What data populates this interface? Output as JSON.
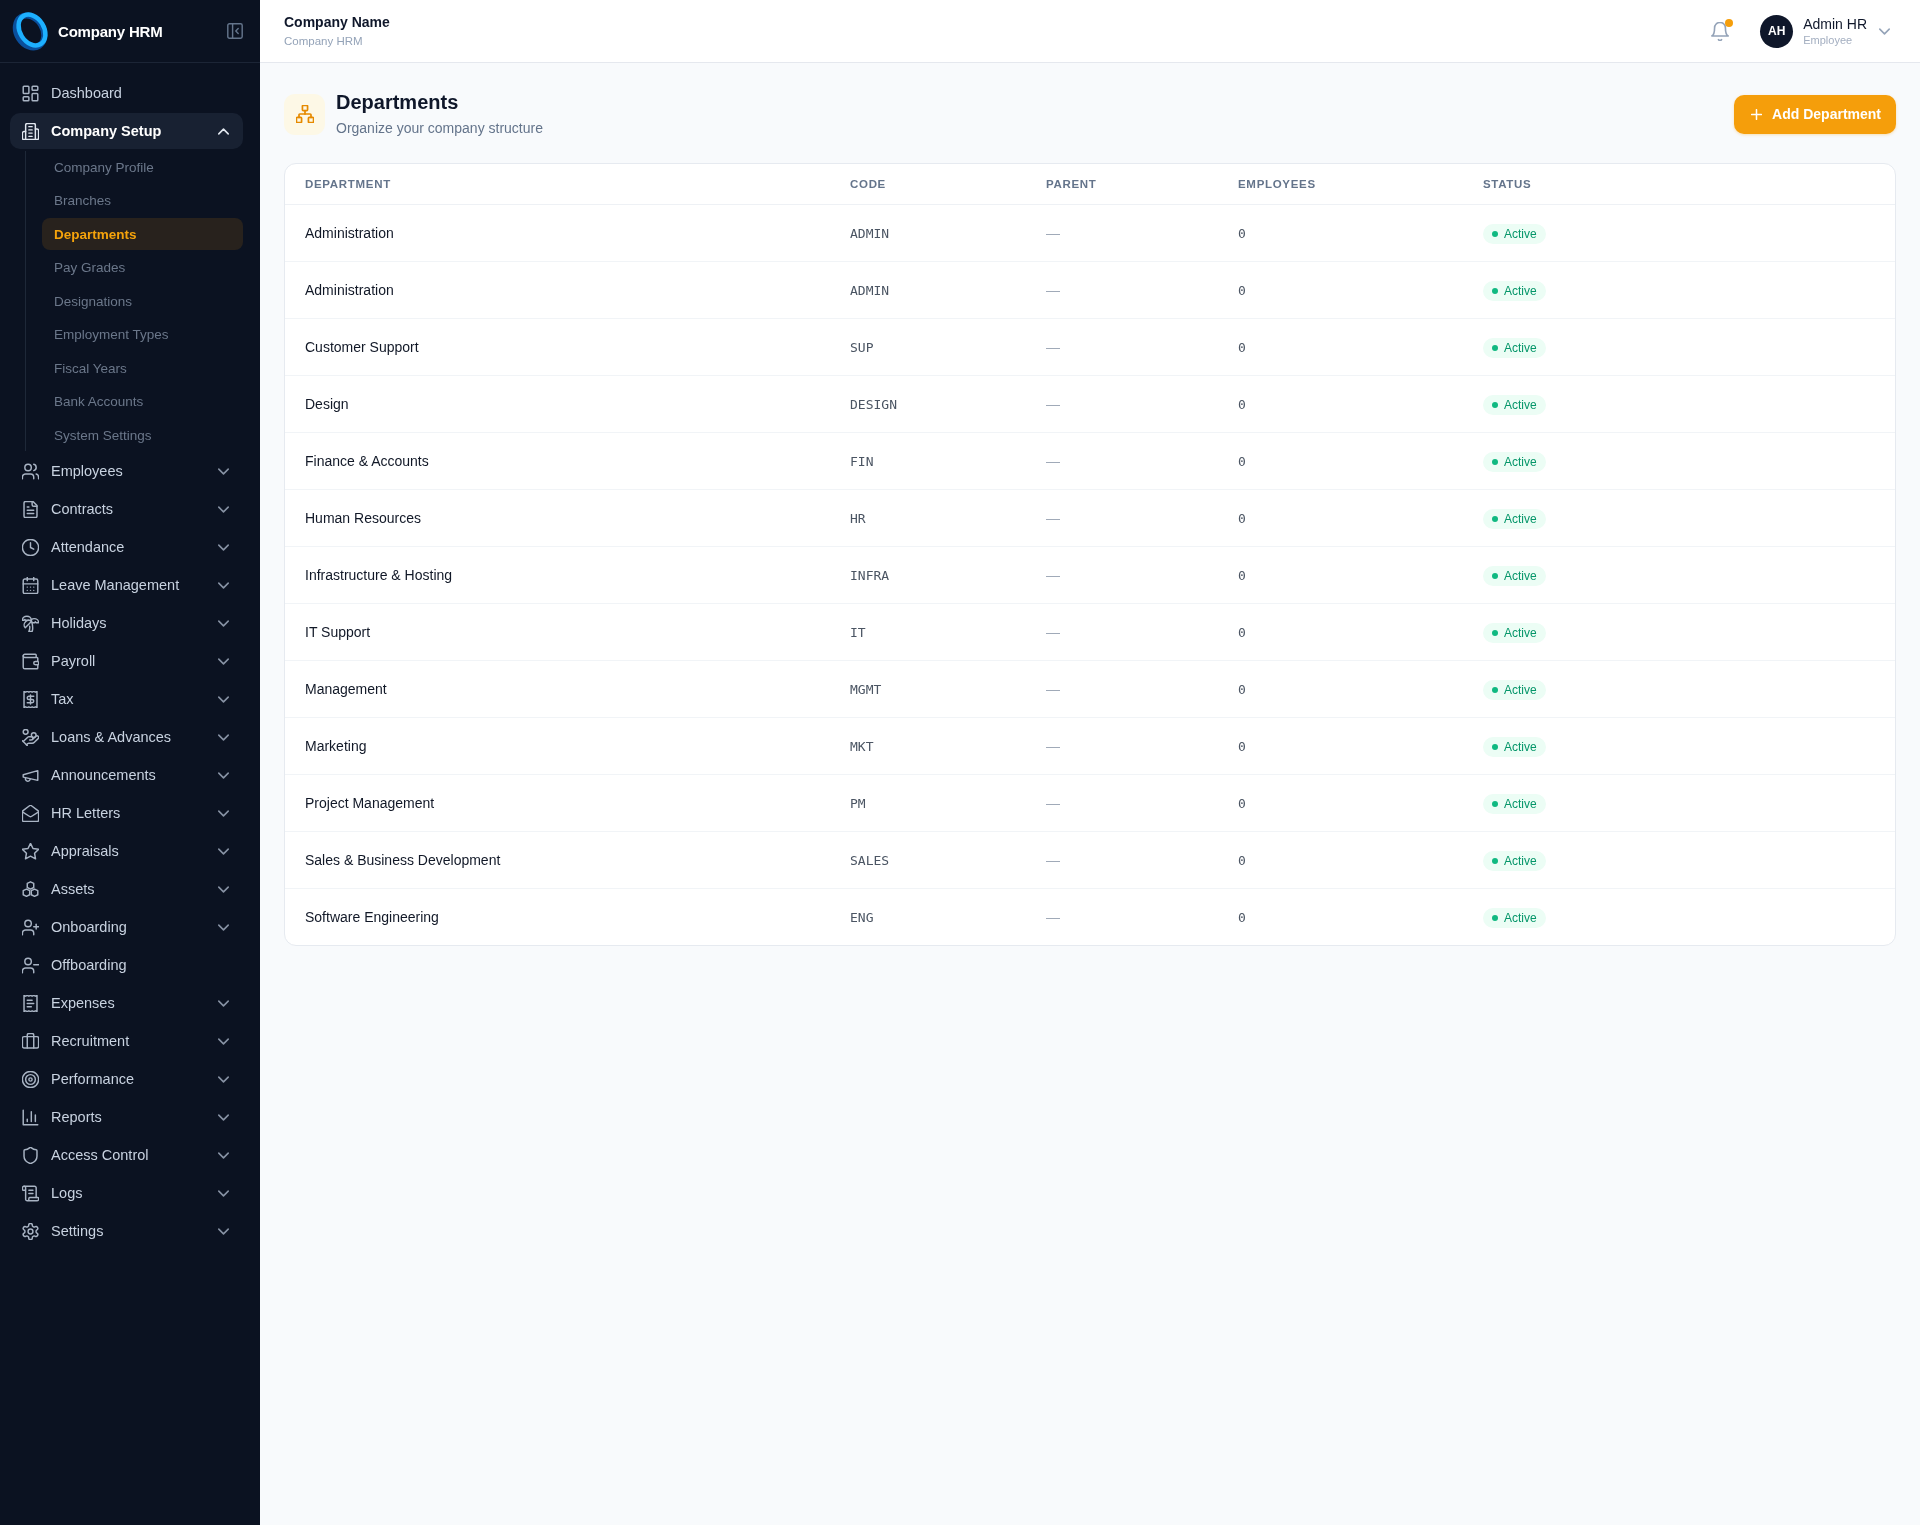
{
  "sidebar": {
    "brand": "Company HRM",
    "items": [
      {
        "label": "Dashboard",
        "kind": "link",
        "selected": false
      },
      {
        "label": "Company Setup",
        "kind": "group",
        "selected": true,
        "expanded": true,
        "children": [
          {
            "label": "Company Profile",
            "selected": false
          },
          {
            "label": "Branches",
            "selected": false
          },
          {
            "label": "Departments",
            "selected": true
          },
          {
            "label": "Pay Grades",
            "selected": false
          },
          {
            "label": "Designations",
            "selected": false
          },
          {
            "label": "Employment Types",
            "selected": false
          },
          {
            "label": "Fiscal Years",
            "selected": false
          },
          {
            "label": "Bank Accounts",
            "selected": false
          },
          {
            "label": "System Settings",
            "selected": false
          }
        ]
      },
      {
        "label": "Employees",
        "kind": "group",
        "selected": false,
        "expanded": false
      },
      {
        "label": "Contracts",
        "kind": "group",
        "selected": false,
        "expanded": false
      },
      {
        "label": "Attendance",
        "kind": "group",
        "selected": false,
        "expanded": false
      },
      {
        "label": "Leave Management",
        "kind": "group",
        "selected": false,
        "expanded": false
      },
      {
        "label": "Holidays",
        "kind": "group",
        "selected": false,
        "expanded": false
      },
      {
        "label": "Payroll",
        "kind": "group",
        "selected": false,
        "expanded": false
      },
      {
        "label": "Tax",
        "kind": "group",
        "selected": false,
        "expanded": false
      },
      {
        "label": "Loans & Advances",
        "kind": "group",
        "selected": false,
        "expanded": false
      },
      {
        "label": "Announcements",
        "kind": "group",
        "selected": false,
        "expanded": false
      },
      {
        "label": "HR Letters",
        "kind": "group",
        "selected": false,
        "expanded": false
      },
      {
        "label": "Appraisals",
        "kind": "group",
        "selected": false,
        "expanded": false
      },
      {
        "label": "Assets",
        "kind": "group",
        "selected": false,
        "expanded": false
      },
      {
        "label": "Onboarding",
        "kind": "group",
        "selected": false,
        "expanded": false
      },
      {
        "label": "Offboarding",
        "kind": "link",
        "selected": false
      },
      {
        "label": "Expenses",
        "kind": "group",
        "selected": false,
        "expanded": false
      },
      {
        "label": "Recruitment",
        "kind": "group",
        "selected": false,
        "expanded": false
      },
      {
        "label": "Performance",
        "kind": "group",
        "selected": false,
        "expanded": false
      },
      {
        "label": "Reports",
        "kind": "group",
        "selected": false,
        "expanded": false
      },
      {
        "label": "Access Control",
        "kind": "group",
        "selected": false,
        "expanded": false
      },
      {
        "label": "Logs",
        "kind": "group",
        "selected": false,
        "expanded": false
      },
      {
        "label": "Settings",
        "kind": "group",
        "selected": false,
        "expanded": false
      }
    ]
  },
  "topbar": {
    "title": "Company Name",
    "subtitle": "Company HRM",
    "has_unread": true,
    "user": {
      "initials": "AH",
      "name": "Admin HR",
      "role": "Employee"
    }
  },
  "page": {
    "title": "Departments",
    "subtitle": "Organize your company structure",
    "action": "Add Department"
  },
  "table": {
    "columns": [
      "DEPARTMENT",
      "CODE",
      "PARENT",
      "EMPLOYEES",
      "STATUS"
    ],
    "rows": [
      {
        "department": "Administration",
        "code": "ADMIN",
        "parent": "—",
        "employees": "0",
        "status": "Active"
      },
      {
        "department": "Administration",
        "code": "ADMIN",
        "parent": "—",
        "employees": "0",
        "status": "Active"
      },
      {
        "department": "Customer Support",
        "code": "SUP",
        "parent": "—",
        "employees": "0",
        "status": "Active"
      },
      {
        "department": "Design",
        "code": "DESIGN",
        "parent": "—",
        "employees": "0",
        "status": "Active"
      },
      {
        "department": "Finance & Accounts",
        "code": "FIN",
        "parent": "—",
        "employees": "0",
        "status": "Active"
      },
      {
        "department": "Human Resources",
        "code": "HR",
        "parent": "—",
        "employees": "0",
        "status": "Active"
      },
      {
        "department": "Infrastructure & Hosting",
        "code": "INFRA",
        "parent": "—",
        "employees": "0",
        "status": "Active"
      },
      {
        "department": "IT Support",
        "code": "IT",
        "parent": "—",
        "employees": "0",
        "status": "Active"
      },
      {
        "department": "Management",
        "code": "MGMT",
        "parent": "—",
        "employees": "0",
        "status": "Active"
      },
      {
        "department": "Marketing",
        "code": "MKT",
        "parent": "—",
        "employees": "0",
        "status": "Active"
      },
      {
        "department": "Project Management",
        "code": "PM",
        "parent": "—",
        "employees": "0",
        "status": "Active"
      },
      {
        "department": "Sales & Business Development",
        "code": "SALES",
        "parent": "—",
        "employees": "0",
        "status": "Active"
      },
      {
        "department": "Software Engineering",
        "code": "ENG",
        "parent": "—",
        "employees": "0",
        "status": "Active"
      }
    ]
  }
}
